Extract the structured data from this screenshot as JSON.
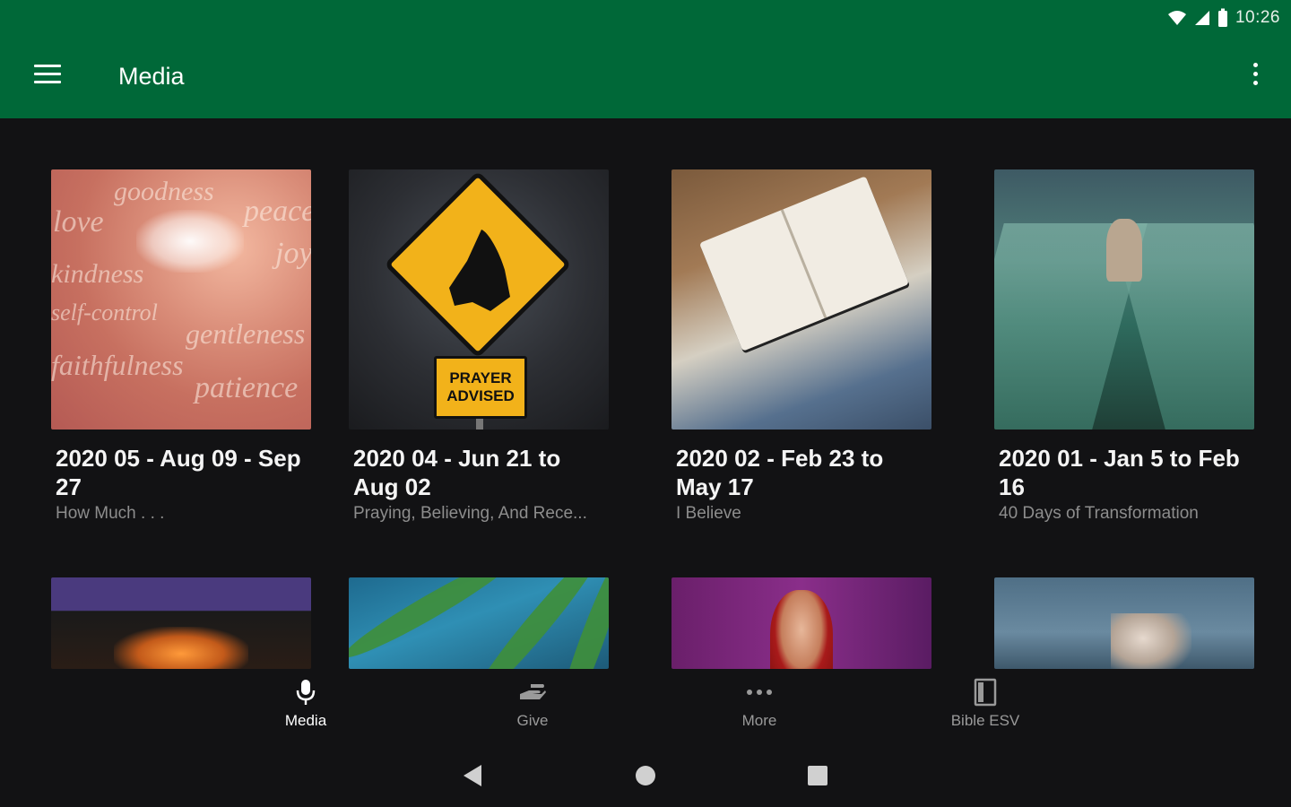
{
  "status_bar": {
    "time": "10:26"
  },
  "app_bar": {
    "title": "Media"
  },
  "colors": {
    "app_bar": "#006838",
    "background": "#121214",
    "accent_text": "#ffffff",
    "muted_text": "#8d8d8d"
  },
  "media_items": [
    {
      "title": "2020 05 - Aug 09 - Sep 27",
      "subtitle": "How Much . . ."
    },
    {
      "title": "2020 04 - Jun 21 to Aug 02",
      "subtitle": "Praying, Believing, And Rece...",
      "sign_text": [
        "PRAYER",
        "ADVISED"
      ]
    },
    {
      "title": "2020 02 - Feb 23 to May 17",
      "subtitle": "I Believe"
    },
    {
      "title": "2020 01 - Jan 5 to Feb 16",
      "subtitle": "40 Days of Transformation"
    }
  ],
  "artwork_words": [
    "goodness",
    "love",
    "peace",
    "joy",
    "kindness",
    "self-control",
    "gentleness",
    "faithfulness",
    "patience"
  ],
  "bottom_nav": [
    {
      "label": "Media",
      "icon": "microphone-icon",
      "active": true
    },
    {
      "label": "Give",
      "icon": "hand-give-icon",
      "active": false
    },
    {
      "label": "More",
      "icon": "more-horiz-icon",
      "active": false
    },
    {
      "label": "Bible ESV",
      "icon": "book-icon",
      "active": false
    }
  ],
  "system_nav": {
    "back_icon": "back-triangle-icon",
    "home_icon": "home-circle-icon",
    "recents_icon": "recents-square-icon"
  }
}
